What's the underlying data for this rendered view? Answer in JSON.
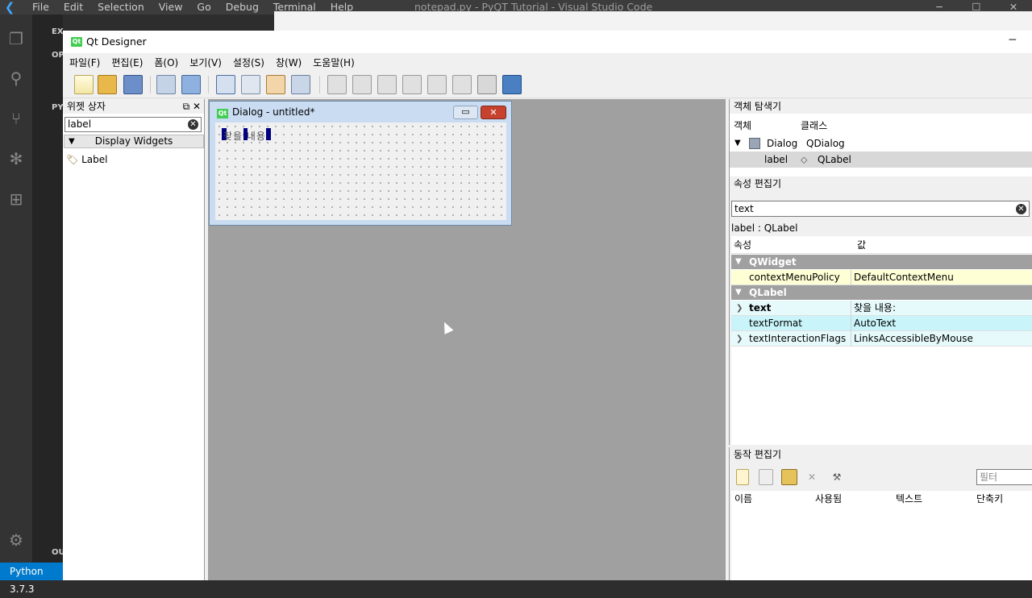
{
  "vscode": {
    "menu": [
      "File",
      "Edit",
      "Selection",
      "View",
      "Go",
      "Debug",
      "Terminal",
      "Help"
    ],
    "title": "notepad.py - PyQT Tutorial - Visual Studio Code",
    "sidebar_headers": [
      "EX",
      "OP",
      "PY",
      "OU"
    ],
    "status": "Python 3.7.3",
    "accent": "#007acc"
  },
  "qt": {
    "window_title": "Qt Designer",
    "menu": [
      "파일(F)",
      "편집(E)",
      "폼(O)",
      "보기(V)",
      "설정(S)",
      "창(W)",
      "도움말(H)"
    ],
    "widget_box": {
      "title": "위젯 상자",
      "filter": "label",
      "category": "Display Widgets",
      "item": "Label"
    },
    "dialog": {
      "title": "Dialog - untitled*",
      "label_text": "찾을 내용"
    },
    "object_inspector": {
      "title": "객체 탐색기",
      "col_object": "객체",
      "col_class": "클래스",
      "rows": [
        {
          "object": "Dialog",
          "class": "QDialog"
        },
        {
          "object": "label",
          "class": "QLabel"
        }
      ]
    },
    "property_editor": {
      "title": "속성 편집기",
      "filter": "text",
      "subtitle": "label : QLabel",
      "col_prop": "속성",
      "col_value": "값",
      "groups": [
        {
          "name": "QWidget",
          "props": [
            {
              "name": "contextMenuPolicy",
              "value": "DefaultContextMenu"
            }
          ]
        },
        {
          "name": "QLabel",
          "props": [
            {
              "name": "text",
              "value": "찾을 내용:"
            },
            {
              "name": "textFormat",
              "value": "AutoText"
            },
            {
              "name": "textInteractionFlags",
              "value": "LinksAccessibleByMouse"
            }
          ]
        }
      ]
    },
    "action_editor": {
      "title": "동작 편집기",
      "filter_placeholder": "필터",
      "columns": [
        "이름",
        "사용됨",
        "텍스트",
        "단축키"
      ]
    }
  }
}
